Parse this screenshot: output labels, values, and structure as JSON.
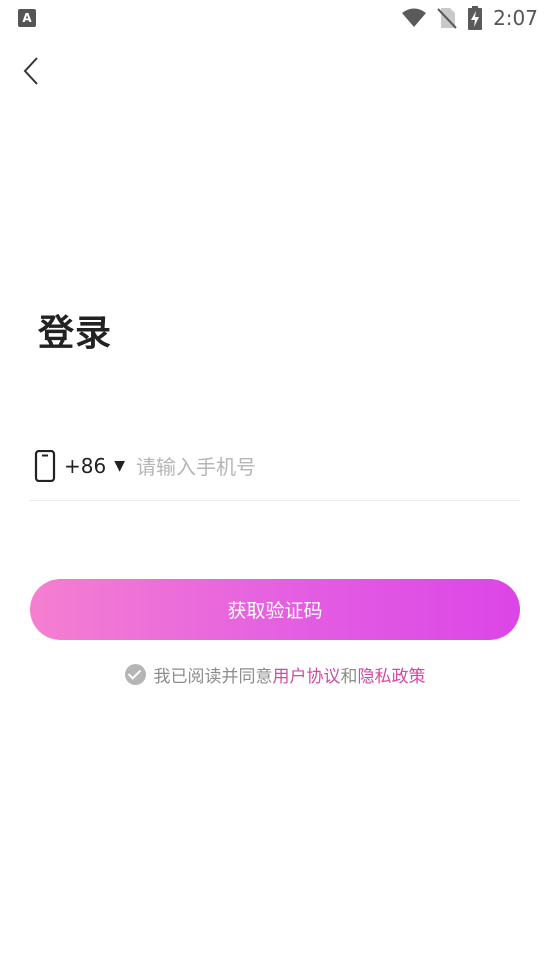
{
  "status_bar": {
    "notification_badge": "A",
    "time": "2:07",
    "icons": [
      "wifi-icon",
      "no-sim-icon",
      "battery-charging-icon"
    ]
  },
  "header": {
    "back_icon": "chevron-left-icon"
  },
  "login": {
    "title": "登录",
    "phone": {
      "icon": "mobile-phone-icon",
      "country_code": "+86",
      "dropdown_indicator": "▼",
      "placeholder": "请输入手机号",
      "value": ""
    },
    "submit_label": "获取验证码",
    "agreement": {
      "checked": true,
      "prefix": "我已阅读并同意",
      "user_agreement": "用户协议",
      "connector": "和",
      "privacy_policy": "隐私政策"
    }
  },
  "colors": {
    "button_gradient_start": "#f57fd0",
    "button_gradient_end": "#dc45e6",
    "link": "#d14aa5",
    "placeholder": "#b6b6b6"
  }
}
